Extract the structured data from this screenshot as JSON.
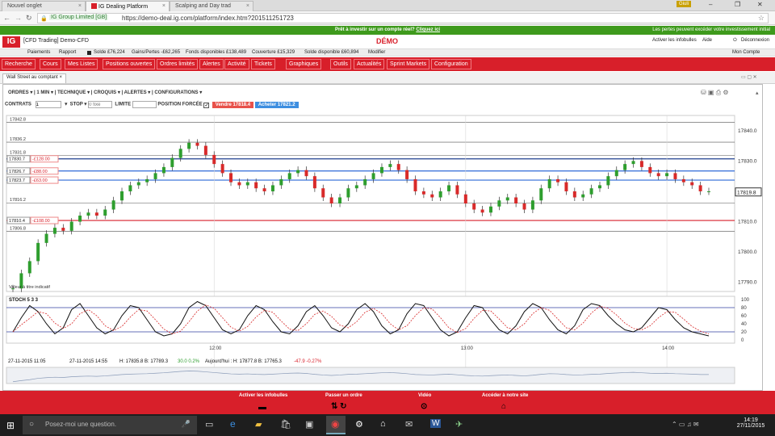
{
  "browser": {
    "tabs": [
      {
        "label": "Nouvel onglet",
        "active": false
      },
      {
        "label": "IG Dealing Platform",
        "active": true
      },
      {
        "label": "Scalping and Day trad",
        "active": false
      }
    ],
    "profile_label": "Giuli",
    "url_prefix": "IG Group Limited [GB]",
    "url": "https://demo-deal.ig.com/platform/index.htm?201511251723"
  },
  "promo": {
    "text": "Prêt à investir sur un compte réel?",
    "link": "Cliquez ici",
    "right_note": "Les pertes peuvent excéder votre investissement initial"
  },
  "header": {
    "logo": "IG",
    "account_name": "[CFD Trading] Demo-CFD",
    "mode": "DÉMO",
    "activate_infobulles": "Activer les infobulles",
    "help": "Aide",
    "logout": "Déconnexion"
  },
  "account_bar": {
    "paiements": "Paiements",
    "rapport": "Rapport",
    "solde": "Solde £76,224",
    "gains_pertes": "Gains/Pertes -£62,265",
    "fonds": "Fonds disponibles £138,489",
    "couverture": "Couverture £15,329",
    "solde_dispo": "Solde disponible £60,894",
    "modifier": "Modifier",
    "mon_compte": "Mon Compte"
  },
  "menu": [
    "Recherche",
    "Cours",
    "Mes Listes",
    "Positions ouvertes",
    "Ordres limités",
    "Alertes",
    "Activité",
    "Tickets",
    "Graphiques",
    "Outils",
    "Actualités",
    "Sprint Markets",
    "Configuration"
  ],
  "panel": {
    "title": "Wall Street au comptant",
    "close": "×"
  },
  "toolbar": {
    "items": [
      "ORDRES",
      "1 MIN",
      "TECHNIQUE",
      "CROQUIS",
      "ALERTES",
      "CONFIGURATIONS"
    ],
    "contrats_label": "CONTRATS",
    "contrats_value": "1",
    "stop_label": "STOP",
    "stop_placeholder": "0 fixe",
    "limite_label": "LIMITE",
    "position_forcee": "POSITION FORCÉE",
    "sell": "Vendre 17818.4",
    "buy": "Acheter 17821.2"
  },
  "chart_data": {
    "type": "line",
    "title": "",
    "price_axis_ticks": [
      17840,
      17830,
      17820,
      17810,
      17800,
      17790
    ],
    "price_axis_labels": [
      "17840.0",
      "17830.0",
      "17820.0",
      "17810.0",
      "17800.0",
      "17790.0"
    ],
    "left_level_labels": [
      "17842.8",
      "17836.2",
      "17831.8",
      "17816.2",
      "17806.8"
    ],
    "time_labels": [
      "12:00",
      "13:00",
      "14:00"
    ],
    "current_price": "17819.8",
    "order_levels": [
      {
        "price": 17830.7,
        "label": "17830.7",
        "pnl": "-£128.00",
        "color": "#1f3f8f"
      },
      {
        "price": 17826.7,
        "label": "17826.7",
        "pnl": "-£88.00",
        "color": "#2f6ad8"
      },
      {
        "price": 17823.7,
        "label": "17823.7",
        "pnl": "-£63.00",
        "color": "#2f6ad8"
      },
      {
        "price": 17810.4,
        "label": "17810.4",
        "pnl": "-£108.00",
        "color": "#d81f2a"
      }
    ],
    "close_series": [
      17788,
      17793,
      17797,
      17803,
      17806,
      17808,
      17807,
      17810,
      17812,
      17813,
      17812,
      17814,
      17817,
      17820,
      17822,
      17823,
      17824,
      17826,
      17828,
      17831,
      17834,
      17836,
      17835,
      17832,
      17829,
      17826,
      17823,
      17822,
      17823,
      17821,
      17820,
      17822,
      17824,
      17826,
      17827,
      17825,
      17821,
      17818,
      17816,
      17818,
      17821,
      17822,
      17824,
      17826,
      17828,
      17829,
      17827,
      17824,
      17820,
      17819,
      17818,
      17820,
      17822,
      17819,
      17816,
      17814,
      17813,
      17815,
      17817,
      17818,
      17816,
      17814,
      17817,
      17821,
      17824,
      17823,
      17820,
      17818,
      17819,
      17821,
      17822,
      17825,
      17827,
      17829,
      17830,
      17828,
      17826,
      17825,
      17826,
      17824,
      17823,
      17822,
      17820,
      17820
    ],
    "stoch": {
      "label": "STOCH 5 3 3",
      "ticks": [
        100,
        80,
        60,
        40,
        20,
        0
      ],
      "k": [
        20,
        55,
        85,
        70,
        40,
        15,
        30,
        75,
        90,
        60,
        30,
        15,
        25,
        60,
        85,
        80,
        50,
        20,
        10,
        15,
        40,
        80,
        95,
        85,
        55,
        25,
        15,
        25,
        60,
        85,
        75,
        45,
        20,
        15,
        35,
        70,
        85,
        60,
        30,
        20,
        40,
        75,
        90,
        70,
        35,
        15,
        25,
        65,
        90,
        85,
        55,
        25,
        10,
        20,
        55,
        85,
        80,
        50,
        25,
        15,
        35,
        70,
        90,
        80,
        50,
        25,
        15,
        35,
        75,
        90,
        85,
        60,
        40,
        25,
        20,
        30,
        55,
        80,
        75,
        50,
        30,
        20,
        15,
        10
      ],
      "overbought": 80,
      "oversold": 20
    },
    "footer": {
      "date_from": "27-11-2015 11:05",
      "date_to": "27-11-2015 14:55",
      "stats": "H: 17835.8 B: 17789.3",
      "change": "30.0  0.2%",
      "today_label": "Aujourd'hui : H: 17877.8 B: 17765.3",
      "today_change": "-47.9  -0.27%"
    },
    "legend_note": "Valeur à titre indicatif"
  },
  "bottom_actions": [
    "Activer les infobulles",
    "Passer un ordre",
    "Vidéo",
    "Accéder à notre site"
  ],
  "taskbar": {
    "search_placeholder": "Posez-moi une question.",
    "time": "14:19",
    "date": "27/11/2015"
  }
}
